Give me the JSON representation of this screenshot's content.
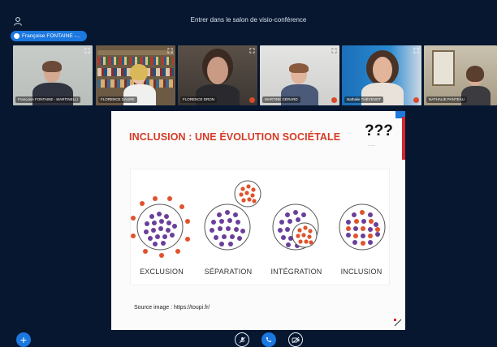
{
  "window": {
    "title": "Entrer dans le salon de visio-conférence"
  },
  "presenter": {
    "label": "Françoise FONTAINE -..."
  },
  "participants": [
    {
      "name": "Françoise FONTAINE - MARTINELLI"
    },
    {
      "name": "FLORENCE DAURE"
    },
    {
      "name": "FLORENCE DRON"
    },
    {
      "name": "MARTINE GÉRARD"
    },
    {
      "name": "Nathalie THÉVENOT"
    },
    {
      "name": "NATHALIE PANTEAU"
    }
  ],
  "slide": {
    "title": "INCLUSION : UNE ÉVOLUTION SOCIÉTALE",
    "question_marks": "???",
    "labels": [
      "EXCLUSION",
      "SÉPARATION",
      "INTÉGRATION",
      "INCLUSION"
    ],
    "source": "Source image : https://toupi.fr/"
  },
  "colors": {
    "background": "#06172f",
    "accent_blue": "#1b78e0",
    "slide_title": "#d63b26",
    "dot_purple": "#6a3f9a",
    "dot_orange": "#e0532c"
  },
  "icons": {
    "user": "user-icon",
    "plus": "plus-icon",
    "mic": "microphone-icon",
    "phone": "phone-icon",
    "camera": "camera-icon",
    "expand": "expand-icon"
  }
}
